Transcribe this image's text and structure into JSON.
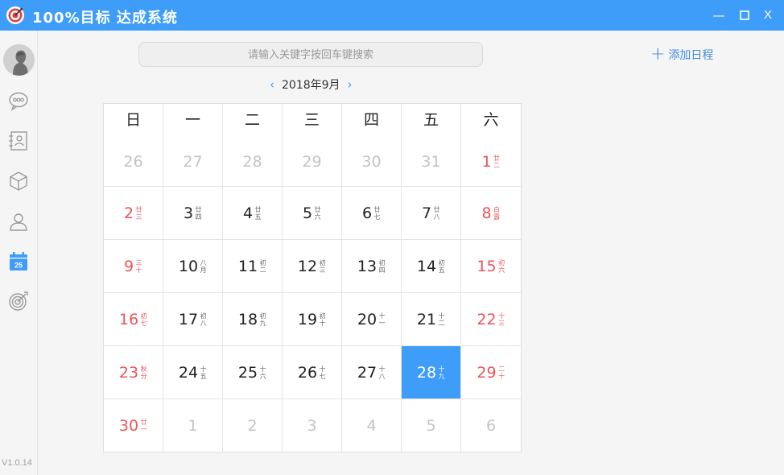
{
  "app": {
    "title": "100%目标 达成系统",
    "version": "V1.0.14",
    "accent_color": "#3f9dfa"
  },
  "window_controls": {
    "minimize": "—",
    "maximize": "☐",
    "close": "X"
  },
  "sidebar": {
    "items": [
      {
        "name": "chat",
        "icon": "chat-bubble-icon"
      },
      {
        "name": "contacts",
        "icon": "contact-card-icon"
      },
      {
        "name": "cube",
        "icon": "cube-icon"
      },
      {
        "name": "profile",
        "icon": "user-icon"
      },
      {
        "name": "calendar",
        "icon": "calendar-icon",
        "active": true,
        "badge": "25"
      },
      {
        "name": "target",
        "icon": "target-icon"
      }
    ]
  },
  "search": {
    "placeholder": "请输入关键字按回车键搜索"
  },
  "add_schedule": {
    "label": "添加日程"
  },
  "calendar": {
    "month_label": "2018年9月",
    "weekdays": [
      "日",
      "一",
      "二",
      "三",
      "四",
      "五",
      "六"
    ],
    "weeks": [
      [
        {
          "day": "26",
          "lunar": "",
          "other": true
        },
        {
          "day": "27",
          "lunar": "",
          "other": true
        },
        {
          "day": "28",
          "lunar": "",
          "other": true
        },
        {
          "day": "29",
          "lunar": "",
          "other": true
        },
        {
          "day": "30",
          "lunar": "",
          "other": true
        },
        {
          "day": "31",
          "lunar": "",
          "other": true
        },
        {
          "day": "1",
          "lunar": "廿二",
          "weekend": true
        }
      ],
      [
        {
          "day": "2",
          "lunar": "廿三",
          "weekend": true
        },
        {
          "day": "3",
          "lunar": "廿四"
        },
        {
          "day": "4",
          "lunar": "廿五"
        },
        {
          "day": "5",
          "lunar": "廿六"
        },
        {
          "day": "6",
          "lunar": "廿七"
        },
        {
          "day": "7",
          "lunar": "廿八"
        },
        {
          "day": "8",
          "lunar": "白露",
          "weekend": true
        }
      ],
      [
        {
          "day": "9",
          "lunar": "三十",
          "weekend": true
        },
        {
          "day": "10",
          "lunar": "八月"
        },
        {
          "day": "11",
          "lunar": "初二"
        },
        {
          "day": "12",
          "lunar": "初三"
        },
        {
          "day": "13",
          "lunar": "初四"
        },
        {
          "day": "14",
          "lunar": "初五"
        },
        {
          "day": "15",
          "lunar": "初六",
          "weekend": true
        }
      ],
      [
        {
          "day": "16",
          "lunar": "初七",
          "weekend": true
        },
        {
          "day": "17",
          "lunar": "初八"
        },
        {
          "day": "18",
          "lunar": "初九"
        },
        {
          "day": "19",
          "lunar": "初十"
        },
        {
          "day": "20",
          "lunar": "十一"
        },
        {
          "day": "21",
          "lunar": "十二"
        },
        {
          "day": "22",
          "lunar": "十三",
          "weekend": true
        }
      ],
      [
        {
          "day": "23",
          "lunar": "秋分",
          "weekend": true
        },
        {
          "day": "24",
          "lunar": "十五"
        },
        {
          "day": "25",
          "lunar": "十六"
        },
        {
          "day": "26",
          "lunar": "十七"
        },
        {
          "day": "27",
          "lunar": "十八"
        },
        {
          "day": "28",
          "lunar": "十九",
          "today": true
        },
        {
          "day": "29",
          "lunar": "二十",
          "weekend": true
        }
      ],
      [
        {
          "day": "30",
          "lunar": "廿一",
          "weekend": true
        },
        {
          "day": "1",
          "lunar": "",
          "other": true
        },
        {
          "day": "2",
          "lunar": "",
          "other": true
        },
        {
          "day": "3",
          "lunar": "",
          "other": true
        },
        {
          "day": "4",
          "lunar": "",
          "other": true
        },
        {
          "day": "5",
          "lunar": "",
          "other": true
        },
        {
          "day": "6",
          "lunar": "",
          "other": true
        }
      ]
    ]
  }
}
